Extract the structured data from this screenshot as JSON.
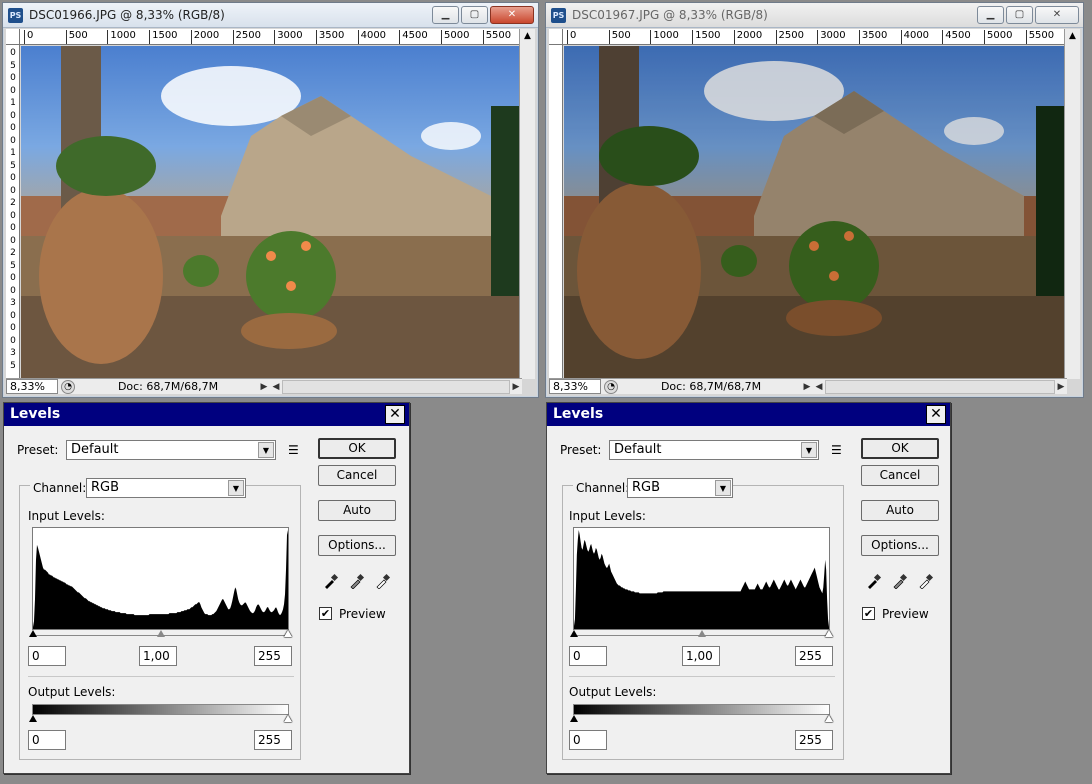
{
  "colors": {
    "dialog_title_bg": "#00007f",
    "window_frame": "#d6d6d6",
    "desktop": "#8a8a8a"
  },
  "windows": [
    {
      "id": "left",
      "app_icon": "PS",
      "title": "DSC01966.JPG @ 8,33% (RGB/8)",
      "ruler_h": [
        "0",
        "500",
        "1000",
        "1500",
        "2000",
        "2500",
        "3000",
        "3500",
        "4000",
        "4500",
        "5000",
        "5500"
      ],
      "ruler_v": [
        "0",
        "5",
        "0",
        "0",
        "1",
        "0",
        "0",
        "0",
        "1",
        "5",
        "0",
        "0",
        "2",
        "0",
        "0",
        "0",
        "2",
        "5",
        "0",
        "0",
        "3",
        "0",
        "0",
        "0",
        "3",
        "5"
      ],
      "zoom": "8,33%",
      "doc_info": "Doc: 68,7M/68,7M",
      "photo_dark": false
    },
    {
      "id": "right",
      "app_icon": "PS",
      "title": "DSC01967.JPG @ 8,33% (RGB/8)",
      "ruler_h": [
        "0",
        "500",
        "1000",
        "1500",
        "2000",
        "2500",
        "3000",
        "3500",
        "4000",
        "4500",
        "5000",
        "5500"
      ],
      "ruler_v": [],
      "zoom": "8,33%",
      "doc_info": "Doc: 68,7M/68,7M",
      "photo_dark": true
    }
  ],
  "levels": [
    {
      "id": "left",
      "title": "Levels",
      "preset_label": "Preset:",
      "preset_value": "Default",
      "channel_label": "Channel:",
      "channel_value": "RGB",
      "input_levels_label": "Input Levels:",
      "output_levels_label": "Output Levels:",
      "input_black": "0",
      "input_gamma": "1,00",
      "input_white": "255",
      "output_black": "0",
      "output_white": "255",
      "buttons": {
        "ok": "OK",
        "cancel": "Cancel",
        "auto": "Auto",
        "options": "Options..."
      },
      "preview_label": "Preview",
      "preview_checked": true,
      "histogram": [
        2,
        8,
        30,
        70,
        85,
        82,
        78,
        74,
        70,
        66,
        62,
        60,
        60,
        59,
        58,
        57,
        55,
        55,
        54,
        54,
        53,
        52,
        52,
        51,
        51,
        50,
        50,
        49,
        49,
        48,
        48,
        47,
        47,
        46,
        45,
        45,
        44,
        44,
        43,
        43,
        42,
        41,
        40,
        39,
        38,
        37,
        37,
        36,
        35,
        34,
        33,
        32,
        31,
        31,
        30,
        29,
        28,
        28,
        27,
        27,
        26,
        26,
        25,
        25,
        24,
        24,
        23,
        23,
        22,
        22,
        21,
        21,
        21,
        20,
        20,
        20,
        19,
        19,
        19,
        18,
        18,
        18,
        18,
        17,
        17,
        17,
        17,
        17,
        16,
        16,
        16,
        16,
        16,
        16,
        15,
        15,
        15,
        15,
        15,
        15,
        15,
        15,
        14,
        14,
        14,
        14,
        14,
        14,
        14,
        14,
        14,
        14,
        14,
        14,
        14,
        14,
        14,
        15,
        15,
        15,
        15,
        15,
        15,
        15,
        15,
        15,
        15,
        15,
        15,
        15,
        15,
        15,
        15,
        15,
        15,
        15,
        15,
        16,
        16,
        16,
        16,
        16,
        16,
        16,
        16,
        17,
        17,
        17,
        17,
        18,
        18,
        18,
        19,
        19,
        19,
        20,
        20,
        20,
        21,
        22,
        22,
        23,
        24,
        25,
        25,
        26,
        27,
        27,
        25,
        22,
        20,
        18,
        16,
        15,
        15,
        15,
        14,
        14,
        14,
        14,
        15,
        15,
        16,
        17,
        18,
        20,
        22,
        24,
        26,
        28,
        30,
        30,
        28,
        26,
        24,
        22,
        20,
        20,
        21,
        24,
        28,
        33,
        38,
        42,
        40,
        35,
        30,
        27,
        25,
        24,
        24,
        25,
        26,
        27,
        26,
        24,
        22,
        20,
        18,
        17,
        16,
        16,
        17,
        19,
        22,
        24,
        25,
        24,
        22,
        20,
        18,
        17,
        17,
        18,
        20,
        22,
        22,
        20,
        18,
        17,
        17,
        18,
        19,
        21,
        22,
        20,
        17,
        15,
        14,
        15,
        17,
        20,
        25,
        35,
        60,
        95,
        100
      ]
    },
    {
      "id": "right",
      "title": "Levels",
      "preset_label": "Preset:",
      "preset_value": "Default",
      "channel_label": "Channel:",
      "channel_value": "RGB",
      "input_levels_label": "Input Levels:",
      "output_levels_label": "Output Levels:",
      "input_black": "0",
      "input_gamma": "1,00",
      "input_white": "255",
      "output_black": "0",
      "output_white": "255",
      "buttons": {
        "ok": "OK",
        "cancel": "Cancel",
        "auto": "Auto",
        "options": "Options..."
      },
      "preview_label": "Preview",
      "preview_checked": true,
      "histogram": [
        3,
        10,
        40,
        75,
        90,
        100,
        95,
        88,
        82,
        80,
        85,
        90,
        88,
        84,
        80,
        78,
        80,
        84,
        86,
        82,
        78,
        76,
        78,
        82,
        80,
        76,
        72,
        70,
        72,
        76,
        74,
        70,
        66,
        64,
        62,
        62,
        64,
        66,
        62,
        58,
        56,
        54,
        52,
        50,
        48,
        46,
        45,
        44,
        44,
        43,
        42,
        42,
        41,
        41,
        40,
        40,
        40,
        39,
        39,
        39,
        38,
        38,
        38,
        38,
        37,
        37,
        37,
        37,
        37,
        36,
        36,
        36,
        36,
        36,
        36,
        36,
        36,
        36,
        36,
        36,
        36,
        36,
        36,
        36,
        36,
        36,
        36,
        36,
        37,
        37,
        37,
        37,
        37,
        37,
        38,
        38,
        38,
        38,
        38,
        38,
        38,
        38,
        38,
        38,
        38,
        38,
        38,
        38,
        38,
        38,
        38,
        38,
        38,
        38,
        38,
        38,
        38,
        38,
        38,
        38,
        38,
        38,
        38,
        38,
        38,
        38,
        38,
        38,
        38,
        38,
        38,
        38,
        38,
        38,
        38,
        38,
        38,
        38,
        38,
        38,
        38,
        38,
        38,
        38,
        38,
        38,
        38,
        38,
        38,
        38,
        38,
        38,
        38,
        38,
        38,
        38,
        38,
        38,
        38,
        38,
        38,
        38,
        38,
        38,
        38,
        38,
        38,
        38,
        38,
        38,
        38,
        38,
        38,
        38,
        38,
        38,
        40,
        42,
        44,
        46,
        48,
        46,
        44,
        42,
        40,
        40,
        40,
        40,
        40,
        40,
        40,
        42,
        44,
        46,
        44,
        42,
        40,
        40,
        40,
        42,
        44,
        46,
        48,
        46,
        44,
        42,
        42,
        44,
        46,
        48,
        50,
        48,
        46,
        44,
        42,
        40,
        40,
        42,
        44,
        46,
        48,
        50,
        48,
        46,
        44,
        44,
        46,
        48,
        50,
        48,
        46,
        44,
        42,
        40,
        42,
        44,
        46,
        48,
        50,
        48,
        46,
        44,
        42,
        42,
        44,
        46,
        48,
        50,
        52,
        54,
        56,
        58,
        60,
        62,
        58,
        54,
        50,
        46,
        42,
        40,
        38,
        36,
        42,
        55,
        70,
        60,
        30,
        10,
        2
      ]
    }
  ]
}
